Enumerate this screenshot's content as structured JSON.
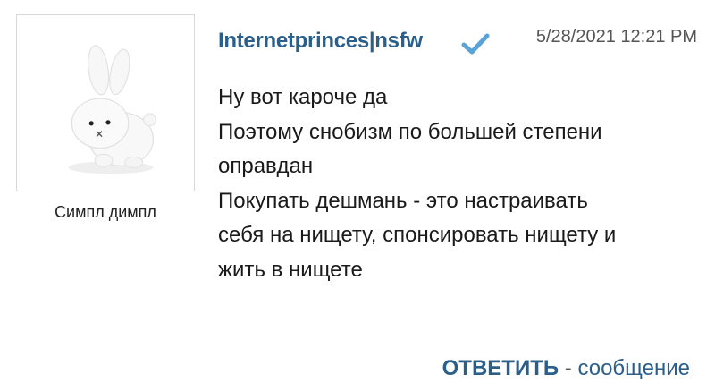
{
  "author": {
    "username": "Internetprinces|nsfw",
    "avatar_caption": "Симпл димпл",
    "avatar_icon": "white-bunny-plush",
    "verified_icon": "checkmark-icon"
  },
  "post": {
    "timestamp": "5/28/2021 12:21 PM",
    "lines": [
      "Ну вот кароче да",
      "Поэтому снобизм по большей степени",
      "оправдан",
      "Покупать дешмань - это настраивать",
      "себя на нищету, спонсировать нищету и",
      "жить в нищете"
    ]
  },
  "footer": {
    "reply_label": "ОТВЕТИТЬ",
    "separator": " - ",
    "tail_label": "сообщение"
  },
  "colors": {
    "accent": "#2b5f8a",
    "check": "#5ba3d6",
    "text": "#1a1a1a",
    "muted": "#555555"
  }
}
